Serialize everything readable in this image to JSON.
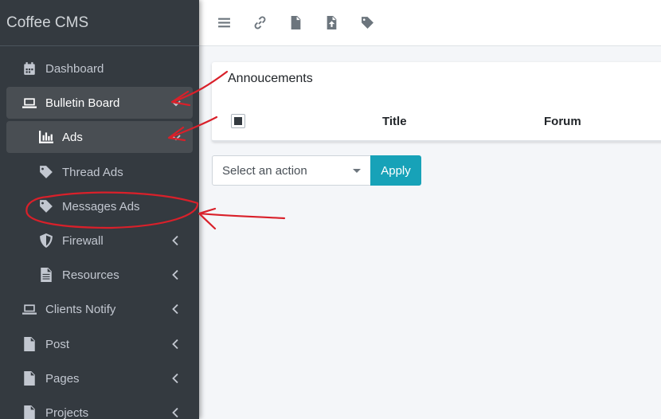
{
  "brand": "Coffee CMS",
  "sidebar": {
    "items": [
      {
        "label": "Dashboard",
        "icon": "calendar-icon",
        "active": false,
        "chevron": ""
      },
      {
        "label": "Bulletin Board",
        "icon": "laptop-icon",
        "active": true,
        "chevron": "down"
      },
      {
        "label": "Ads",
        "icon": "bar-chart-icon",
        "active": true,
        "chevron": "down"
      },
      {
        "label": "Thread Ads",
        "icon": "tag-icon",
        "active": false,
        "chevron": ""
      },
      {
        "label": "Messages Ads",
        "icon": "tag-icon",
        "active": false,
        "chevron": ""
      },
      {
        "label": "Firewall",
        "icon": "shield-icon",
        "active": false,
        "chevron": "left"
      },
      {
        "label": "Resources",
        "icon": "file-icon",
        "active": false,
        "chevron": "left"
      },
      {
        "label": "Clients Notify",
        "icon": "laptop-icon",
        "active": false,
        "chevron": "left"
      },
      {
        "label": "Post",
        "icon": "file-icon",
        "active": false,
        "chevron": "left"
      },
      {
        "label": "Pages",
        "icon": "file-icon",
        "active": false,
        "chevron": "left"
      },
      {
        "label": "Projects",
        "icon": "file-icon",
        "active": false,
        "chevron": "left"
      }
    ]
  },
  "toolbar": {
    "icons": [
      "menu-icon",
      "link-icon",
      "file-icon",
      "file-upload-icon",
      "tag-icon"
    ]
  },
  "card": {
    "title": "Annoucements",
    "columns": [
      "Title",
      "Forum"
    ]
  },
  "bulk": {
    "select_value": "Select an action",
    "apply_label": "Apply"
  },
  "colors": {
    "sidebar_bg": "#343a40",
    "active_bg": "#494e53",
    "accent": "#17a2b8",
    "annotation": "#d9202a"
  }
}
